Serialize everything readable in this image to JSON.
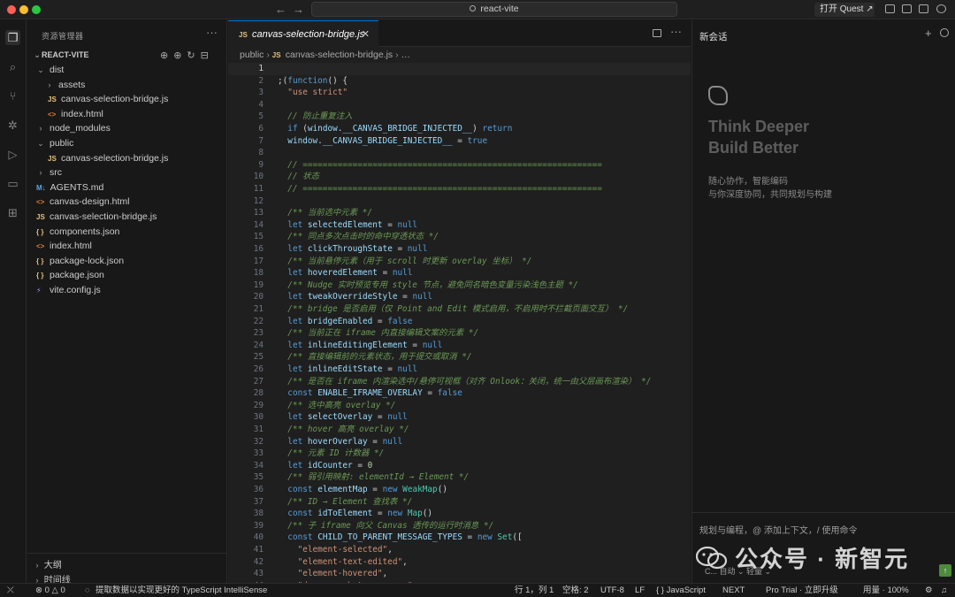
{
  "window": {
    "search_text": "react-vite",
    "quest_button": "打开 Quest ↗"
  },
  "sidebar": {
    "title": "资源管理器",
    "section": "REACT-VITE",
    "tree": [
      {
        "label": "dist",
        "depth": 1,
        "type": "folder",
        "open": true
      },
      {
        "label": "assets",
        "depth": 2,
        "type": "folder",
        "open": false
      },
      {
        "label": "canvas-selection-bridge.js",
        "depth": 2,
        "type": "js"
      },
      {
        "label": "index.html",
        "depth": 2,
        "type": "html"
      },
      {
        "label": "node_modules",
        "depth": 1,
        "type": "folder",
        "open": false
      },
      {
        "label": "public",
        "depth": 1,
        "type": "folder",
        "open": true
      },
      {
        "label": "canvas-selection-bridge.js",
        "depth": 2,
        "type": "js"
      },
      {
        "label": "src",
        "depth": 1,
        "type": "folder",
        "open": false
      },
      {
        "label": "AGENTS.md",
        "depth": 1,
        "type": "md"
      },
      {
        "label": "canvas-design.html",
        "depth": 1,
        "type": "html"
      },
      {
        "label": "canvas-selection-bridge.js",
        "depth": 1,
        "type": "js"
      },
      {
        "label": "components.json",
        "depth": 1,
        "type": "json"
      },
      {
        "label": "index.html",
        "depth": 1,
        "type": "html"
      },
      {
        "label": "package-lock.json",
        "depth": 1,
        "type": "json"
      },
      {
        "label": "package.json",
        "depth": 1,
        "type": "json"
      },
      {
        "label": "vite.config.js",
        "depth": 1,
        "type": "vite"
      }
    ],
    "outline": "大纲",
    "timeline": "时间线"
  },
  "editor": {
    "tab_label": "canvas-selection-bridge.js",
    "breadcrumb": [
      "public",
      "canvas-selection-bridge.js",
      "…"
    ],
    "lines": [
      [],
      [
        [
          "p",
          ";("
        ],
        [
          "k",
          "function"
        ],
        [
          "p",
          "() {"
        ]
      ],
      [
        [
          "p",
          "  "
        ],
        [
          "s",
          "\"use strict\""
        ]
      ],
      [],
      [
        [
          "c",
          "  // 防止重复注入"
        ]
      ],
      [
        [
          "p",
          "  "
        ],
        [
          "k",
          "if"
        ],
        [
          "p",
          " ("
        ],
        [
          "id",
          "window"
        ],
        [
          "p",
          "."
        ],
        [
          "id",
          "__CANVAS_BRIDGE_INJECTED__"
        ],
        [
          "p",
          ") "
        ],
        [
          "k",
          "return"
        ]
      ],
      [
        [
          "p",
          "  "
        ],
        [
          "id",
          "window"
        ],
        [
          "p",
          "."
        ],
        [
          "id",
          "__CANVAS_BRIDGE_INJECTED__"
        ],
        [
          "p",
          " = "
        ],
        [
          "k",
          "true"
        ]
      ],
      [],
      [
        [
          "c",
          "  // ============================================================"
        ]
      ],
      [
        [
          "c",
          "  // 状态"
        ]
      ],
      [
        [
          "c",
          "  // ============================================================"
        ]
      ],
      [],
      [
        [
          "c",
          "  /** 当前选中元素 */"
        ]
      ],
      [
        [
          "p",
          "  "
        ],
        [
          "k",
          "let"
        ],
        [
          "p",
          " "
        ],
        [
          "id",
          "selectedElement"
        ],
        [
          "p",
          " = "
        ],
        [
          "k",
          "null"
        ]
      ],
      [
        [
          "c",
          "  /** 同点多次点击时的命中穿透状态 */"
        ]
      ],
      [
        [
          "p",
          "  "
        ],
        [
          "k",
          "let"
        ],
        [
          "p",
          " "
        ],
        [
          "id",
          "clickThroughState"
        ],
        [
          "p",
          " = "
        ],
        [
          "k",
          "null"
        ]
      ],
      [
        [
          "c",
          "  /** 当前悬停元素（用于 scroll 时更新 overlay 坐标） */"
        ]
      ],
      [
        [
          "p",
          "  "
        ],
        [
          "k",
          "let"
        ],
        [
          "p",
          " "
        ],
        [
          "id",
          "hoveredElement"
        ],
        [
          "p",
          " = "
        ],
        [
          "k",
          "null"
        ]
      ],
      [
        [
          "c",
          "  /** Nudge 实时预览专用 style 节点，避免同名暗色变量污染浅色主题 */"
        ]
      ],
      [
        [
          "p",
          "  "
        ],
        [
          "k",
          "let"
        ],
        [
          "p",
          " "
        ],
        [
          "id",
          "tweakOverrideStyle"
        ],
        [
          "p",
          " = "
        ],
        [
          "k",
          "null"
        ]
      ],
      [
        [
          "c",
          "  /** bridge 是否启用（仅 Point and Edit 模式启用，不启用时不拦截页面交互） */"
        ]
      ],
      [
        [
          "p",
          "  "
        ],
        [
          "k",
          "let"
        ],
        [
          "p",
          " "
        ],
        [
          "id",
          "bridgeEnabled"
        ],
        [
          "p",
          " = "
        ],
        [
          "k",
          "false"
        ]
      ],
      [
        [
          "c",
          "  /** 当前正在 iframe 内直接编辑文案的元素 */"
        ]
      ],
      [
        [
          "p",
          "  "
        ],
        [
          "k",
          "let"
        ],
        [
          "p",
          " "
        ],
        [
          "id",
          "inlineEditingElement"
        ],
        [
          "p",
          " = "
        ],
        [
          "k",
          "null"
        ]
      ],
      [
        [
          "c",
          "  /** 直接编辑前的元素状态，用于提交或取消 */"
        ]
      ],
      [
        [
          "p",
          "  "
        ],
        [
          "k",
          "let"
        ],
        [
          "p",
          " "
        ],
        [
          "id",
          "inlineEditState"
        ],
        [
          "p",
          " = "
        ],
        [
          "k",
          "null"
        ]
      ],
      [
        [
          "c",
          "  /** 是否在 iframe 内渲染选中/悬停可视框（对齐 Onlook：关闭，统一由父层画布渲染） */"
        ]
      ],
      [
        [
          "p",
          "  "
        ],
        [
          "k",
          "const"
        ],
        [
          "p",
          " "
        ],
        [
          "id",
          "ENABLE_IFRAME_OVERLAY"
        ],
        [
          "p",
          " = "
        ],
        [
          "k",
          "false"
        ]
      ],
      [
        [
          "c",
          "  /** 选中高亮 overlay */"
        ]
      ],
      [
        [
          "p",
          "  "
        ],
        [
          "k",
          "let"
        ],
        [
          "p",
          " "
        ],
        [
          "id",
          "selectOverlay"
        ],
        [
          "p",
          " = "
        ],
        [
          "k",
          "null"
        ]
      ],
      [
        [
          "c",
          "  /** hover 高亮 overlay */"
        ]
      ],
      [
        [
          "p",
          "  "
        ],
        [
          "k",
          "let"
        ],
        [
          "p",
          " "
        ],
        [
          "id",
          "hoverOverlay"
        ],
        [
          "p",
          " = "
        ],
        [
          "k",
          "null"
        ]
      ],
      [
        [
          "c",
          "  /** 元素 ID 计数器 */"
        ]
      ],
      [
        [
          "p",
          "  "
        ],
        [
          "k",
          "let"
        ],
        [
          "p",
          " "
        ],
        [
          "id",
          "idCounter"
        ],
        [
          "p",
          " = "
        ],
        [
          "num",
          "0"
        ]
      ],
      [
        [
          "c",
          "  /** 弱引用映射: elementId → Element */"
        ]
      ],
      [
        [
          "p",
          "  "
        ],
        [
          "k",
          "const"
        ],
        [
          "p",
          " "
        ],
        [
          "id",
          "elementMap"
        ],
        [
          "p",
          " = "
        ],
        [
          "k",
          "new"
        ],
        [
          "p",
          " "
        ],
        [
          "cls",
          "WeakMap"
        ],
        [
          "p",
          "()"
        ]
      ],
      [
        [
          "c",
          "  /** ID → Element 查找表 */"
        ]
      ],
      [
        [
          "p",
          "  "
        ],
        [
          "k",
          "const"
        ],
        [
          "p",
          " "
        ],
        [
          "id",
          "idToElement"
        ],
        [
          "p",
          " = "
        ],
        [
          "k",
          "new"
        ],
        [
          "p",
          " "
        ],
        [
          "cls",
          "Map"
        ],
        [
          "p",
          "()"
        ]
      ],
      [
        [
          "c",
          "  /** 子 iframe 向父 Canvas 透传的运行时消息 */"
        ]
      ],
      [
        [
          "p",
          "  "
        ],
        [
          "k",
          "const"
        ],
        [
          "p",
          " "
        ],
        [
          "id",
          "CHILD_TO_PARENT_MESSAGE_TYPES"
        ],
        [
          "p",
          " = "
        ],
        [
          "k",
          "new"
        ],
        [
          "p",
          " "
        ],
        [
          "cls",
          "Set"
        ],
        [
          "p",
          "(["
        ]
      ],
      [
        [
          "p",
          "    "
        ],
        [
          "s",
          "\"element-selected\""
        ],
        [
          "p",
          ","
        ]
      ],
      [
        [
          "p",
          "    "
        ],
        [
          "s",
          "\"element-text-edited\""
        ],
        [
          "p",
          ","
        ]
      ],
      [
        [
          "p",
          "    "
        ],
        [
          "s",
          "\"element-hovered\""
        ],
        [
          "p",
          ","
        ]
      ],
      [
        [
          "p",
          "    "
        ],
        [
          "s",
          "\"dom-snapshot-response\""
        ],
        [
          "p",
          ","
        ]
      ]
    ]
  },
  "chat": {
    "title": "新会话",
    "headline1": "Think Deeper",
    "headline2": "Build Better",
    "sub1": "随心协作，智能编码",
    "sub2": "与你深度协同，共同规划与构建",
    "input_placeholder": "规划与编程，@ 添加上下文，/ 使用命令",
    "model": "C... 自动 ⌄   轻量 ⌄",
    "watermark": "公众号 · 新智元"
  },
  "statusbar": {
    "problems": "⊗ 0 △ 0",
    "loading": "提取数据以实现更好的 TypeScript IntelliSense",
    "position": "行 1，列 1",
    "spaces": "空格: 2",
    "encoding": "UTF-8",
    "eol": "LF",
    "language": "{ } JavaScript",
    "next": "NEXT",
    "pro": "Pro Trial · 立即升级",
    "usage": "用量 · 100%"
  }
}
